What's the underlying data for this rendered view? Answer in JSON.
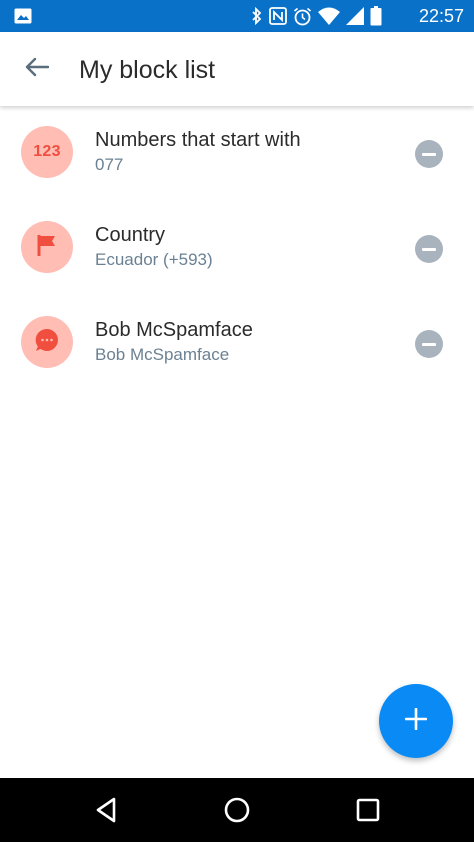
{
  "status_bar": {
    "time": "22:57",
    "icons": [
      "image-icon",
      "bluetooth-icon",
      "nfc-icon",
      "alarm-icon",
      "wifi-icon",
      "signal-icon",
      "battery-icon"
    ],
    "background": "#0a71c9"
  },
  "app_bar": {
    "title": "My block list",
    "back_icon": "arrow-back-icon"
  },
  "block_list": [
    {
      "avatar_text": "123",
      "avatar_icon": "numbers-icon",
      "title": "Numbers that start with",
      "subtitle": "077"
    },
    {
      "avatar_text": "",
      "avatar_icon": "flag-icon",
      "title": "Country",
      "subtitle": "Ecuador (+593)"
    },
    {
      "avatar_text": "",
      "avatar_icon": "message-icon",
      "title": "Bob McSpamface",
      "subtitle": "Bob McSpamface"
    }
  ],
  "colors": {
    "accent": "#0a8af5",
    "avatar_bg": "#ffbdb4",
    "avatar_fg": "#f04e3e",
    "remove_button": "#a8b3bd",
    "subtitle": "#6b8193"
  },
  "fab": {
    "icon": "plus-icon"
  },
  "nav_bar": {
    "icons": [
      "nav-back-icon",
      "nav-home-icon",
      "nav-recents-icon"
    ]
  }
}
